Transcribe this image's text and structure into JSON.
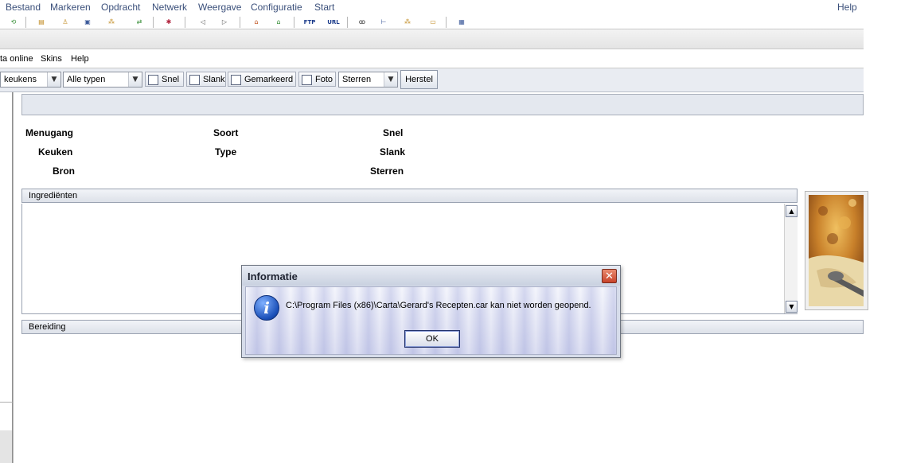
{
  "outer_menu": [
    "Bestand",
    "Markeren",
    "Opdracht",
    "Netwerk",
    "Weergave",
    "Configuratie",
    "Start"
  ],
  "outer_help": "Help",
  "toolbar_icons": [
    {
      "name": "refresh-icon",
      "glyph": "⟲",
      "color": "#2f8a2f"
    },
    {
      "name": "recipes-icon",
      "glyph": "▤",
      "color": "#c08a20"
    },
    {
      "name": "person-icon",
      "glyph": "♙",
      "color": "#c08a20"
    },
    {
      "name": "window-icon",
      "glyph": "▣",
      "color": "#3c5a9a"
    },
    {
      "name": "share-icon",
      "glyph": "⁂",
      "color": "#c08a20"
    },
    {
      "name": "transfer-icon",
      "glyph": "⇄",
      "color": "#2f8a2f"
    },
    {
      "name": "bug-icon",
      "glyph": "✱",
      "color": "#b0203a"
    },
    {
      "name": "back-icon",
      "glyph": "◁",
      "color": "#555555"
    },
    {
      "name": "forward-icon",
      "glyph": "▷",
      "color": "#555555"
    },
    {
      "name": "home-icon",
      "glyph": "⌂",
      "color": "#c0501a"
    },
    {
      "name": "house-icon",
      "glyph": "⌂",
      "color": "#2f8a2f"
    },
    {
      "name": "ftp-icon",
      "glyph": "FTP",
      "color": "#1a3a8a"
    },
    {
      "name": "url-icon",
      "glyph": "URL",
      "color": "#1a3a8a"
    },
    {
      "name": "binoculars-icon",
      "glyph": "ꝏ",
      "color": "#222222"
    },
    {
      "name": "tree-icon",
      "glyph": "⊢",
      "color": "#3c5a9a"
    },
    {
      "name": "network-icon",
      "glyph": "⁂",
      "color": "#c08a20"
    },
    {
      "name": "lock-icon",
      "glyph": "▭",
      "color": "#c08a20"
    },
    {
      "name": "calendar-icon",
      "glyph": "▦",
      "color": "#3c5a9a"
    }
  ],
  "inner_menu": [
    "ta online",
    "Skins",
    "Help"
  ],
  "filters": {
    "kitchen": "keukens",
    "types": "Alle typen",
    "snel": "Snel",
    "slank": "Slank",
    "gemarkeerd": "Gemarkeerd",
    "foto": "Foto",
    "stars": "Sterren",
    "reset": "Herstel"
  },
  "fields": {
    "menugang": "Menugang",
    "keuken": "Keuken",
    "bron": "Bron",
    "soort": "Soort",
    "type": "Type",
    "snel": "Snel",
    "slank": "Slank",
    "sterren": "Sterren"
  },
  "sections": {
    "ingredients": "Ingrediënten",
    "preparation": "Bereiding"
  },
  "dialog": {
    "title": "Informatie",
    "message": "C:\\Program Files (x86)\\Carta\\Gerard's Recepten.car kan niet worden geopend.",
    "ok": "OK",
    "close": "✕",
    "icon_glyph": "i"
  },
  "colors": {
    "menu_text": "#3a4f7a",
    "close_red": "#c8432a"
  }
}
